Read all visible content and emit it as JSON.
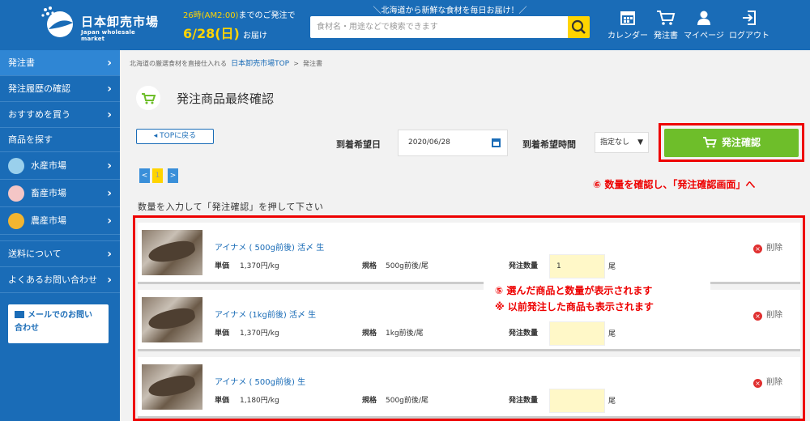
{
  "header": {
    "logo_title": "日本卸売市場",
    "logo_subtitle": "Japan wholesale market",
    "delivery_line1_highlight": "26時(AM2:00)",
    "delivery_line1_rest": "までのご発注で",
    "delivery_date": "6/28(日)",
    "delivery_suffix": "お届け",
    "tagline": "＼北海道から新鮮な食材を毎日お届け！／",
    "search_placeholder": "食材名・用途などで検索できます",
    "nav": {
      "calendar": "カレンダー",
      "order": "発注書",
      "mypage": "マイページ",
      "logout": "ログアウト"
    }
  },
  "sidebar": {
    "items_top": [
      "発注書",
      "発注履歴の確認",
      "おすすめを買う"
    ],
    "search_head": "商品を探す",
    "categories": [
      "水産市場",
      "畜産市場",
      "農産市場"
    ],
    "items_bottom": [
      "送料について",
      "よくあるお問い合わせ"
    ],
    "mail_line1": "メールでのお問い",
    "mail_line2": "合わせ"
  },
  "breadcrumb": {
    "prefix": "北海道の厳選食材を直接仕入れる",
    "link": "日本卸売市場TOP",
    "separator": ">",
    "current": "発注書"
  },
  "page_title": "発注商品最終確認",
  "back_label": "◂ TOPに戻る",
  "date_label": "到着希望日",
  "date_value": "2020/06/28",
  "time_label": "到着希望時間",
  "time_value": "指定なし",
  "confirm_label": "発注確認",
  "annotation_top": "⑥ 数量を確認し、「発注確認画面」へ",
  "pager": {
    "prev": "<",
    "current": "1",
    "next": ">"
  },
  "instruction": "数量を入力して「発注確認」を押して下さい",
  "annotation_mid_line1": "⑤ 選んだ商品と数量が表示されます",
  "annotation_mid_line2": "※ 以前発注した商品も表示されます",
  "labels": {
    "unit_price": "単価",
    "spec": "規格",
    "order_qty": "発注数量",
    "unit": "尾",
    "delete": "削除"
  },
  "products": [
    {
      "name": "アイナメ ( 500g前後) 活〆 生",
      "price": "1,370円/kg",
      "spec": "500g前後/尾",
      "qty": "1"
    },
    {
      "name": "アイナメ (1kg前後) 活〆 生",
      "price": "1,370円/kg",
      "spec": "1kg前後/尾",
      "qty": ""
    },
    {
      "name": "アイナメ ( 500g前後) 生",
      "price": "1,180円/kg",
      "spec": "500g前後/尾",
      "qty": ""
    }
  ],
  "colors": {
    "brand_blue": "#1a6cb7",
    "accent_yellow": "#ffd400",
    "confirm_green": "#6ebe2a",
    "annotation_red": "#ee0000"
  }
}
